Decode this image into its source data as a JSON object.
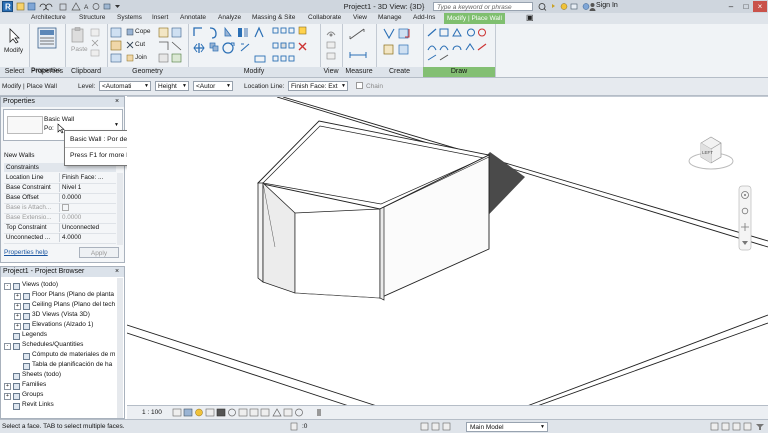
{
  "titlebar": {
    "title": "Project1 - 3D View: {3D}",
    "search_placeholder": "Type a keyword or phrase",
    "sign_in": "Sign In"
  },
  "tabs": [
    "Architecture",
    "Structure",
    "Systems",
    "Insert",
    "Annotate",
    "Analyze",
    "Massing & Site",
    "Collaborate",
    "View",
    "Manage",
    "Add-Ins",
    "Modify | Place Wall"
  ],
  "ribbon": {
    "select_panel": {
      "label": "Select",
      "modify": "Modify"
    },
    "properties_panel": {
      "label": "Properties",
      "properties": "Properties"
    },
    "clipboard_panel": {
      "label": "Clipboard",
      "paste": "Paste"
    },
    "geometry_panel": {
      "label": "Geometry",
      "cope": "Cope",
      "cut": "Cut",
      "join": "Join"
    },
    "modify_panel": {
      "label": "Modify"
    },
    "view_panel": {
      "label": "View"
    },
    "measure_panel": {
      "label": "Measure"
    },
    "create_panel": {
      "label": "Create"
    },
    "draw_panel": {
      "label": "Draw"
    }
  },
  "optionsbar": {
    "context": "Modify | Place Wall",
    "level_label": "Level:",
    "level_value": "<Automati",
    "height_value": "Height",
    "height_to": "<Autor",
    "location_label": "Location Line:",
    "location_value": "Finish Face: Ext",
    "chain": "Chain"
  },
  "properties": {
    "title": "Properties",
    "type_family": "Basic Wall",
    "type_name": "Po:",
    "instance_filter": "New Walls",
    "section": "Constraints",
    "rows": [
      {
        "k": "Location Line",
        "v": "Finish Face: ...",
        "dim": false
      },
      {
        "k": "Base Constraint",
        "v": "Nivel 1",
        "dim": false
      },
      {
        "k": "Base Offset",
        "v": "0.0000",
        "dim": false
      },
      {
        "k": "Base is Attach...",
        "v": "",
        "dim": true
      },
      {
        "k": "Base Extensio...",
        "v": "0.0000",
        "dim": true
      },
      {
        "k": "Top Constraint",
        "v": "Unconnected",
        "dim": false
      },
      {
        "k": "Unconnected ...",
        "v": "4.0000",
        "dim": false
      }
    ],
    "help_link": "Properties help",
    "apply": "Apply"
  },
  "tooltip": {
    "line1": "Basic Wall : Por defecto - 30 cm",
    "line2": "Press F1 for more help"
  },
  "browser": {
    "title": "Project1 - Project Browser",
    "items": [
      {
        "label": "Views (todo)",
        "indent": 0,
        "box": "-"
      },
      {
        "label": "Floor Plans (Plano de planta",
        "indent": 1,
        "box": "+"
      },
      {
        "label": "Ceiling Plans (Plano del tech",
        "indent": 1,
        "box": "+"
      },
      {
        "label": "3D Views (Vista 3D)",
        "indent": 1,
        "box": "+"
      },
      {
        "label": "Elevations (Alzado 1)",
        "indent": 1,
        "box": "+"
      },
      {
        "label": "Legends",
        "indent": 0,
        "box": ""
      },
      {
        "label": "Schedules/Quantities",
        "indent": 0,
        "box": "-"
      },
      {
        "label": "Cómputo de materiales de m",
        "indent": 1,
        "box": ""
      },
      {
        "label": "Tabla de planificación de ha",
        "indent": 1,
        "box": ""
      },
      {
        "label": "Sheets (todo)",
        "indent": 0,
        "box": ""
      },
      {
        "label": "Families",
        "indent": 0,
        "box": "+"
      },
      {
        "label": "Groups",
        "indent": 0,
        "box": "+"
      },
      {
        "label": "Revit Links",
        "indent": 0,
        "box": ""
      }
    ]
  },
  "viewcube": {
    "face": "LEFT"
  },
  "viewctrl": {
    "scale": "1 : 100"
  },
  "status": {
    "message": "Select a face. TAB to select multiple faces.",
    "filter_count": ":0",
    "model": "Main Model"
  },
  "colors": {
    "accent_green": "#7fbf6f",
    "panel_grey": "#dde3ea"
  }
}
